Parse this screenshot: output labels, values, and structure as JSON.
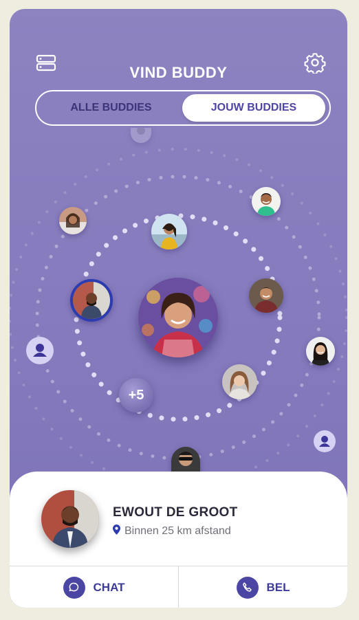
{
  "header": {
    "title": "VIND BUDDY",
    "menu_icon": "server-menu-icon",
    "settings_icon": "gear-icon"
  },
  "tabs": {
    "all": "ALLE BUDDIES",
    "mine": "JOUW BUDDIES",
    "selected": "mine"
  },
  "radar": {
    "more_count": "+5"
  },
  "profile": {
    "name": "EWOUT DE GROOT",
    "distance": "Binnen 25 km afstand"
  },
  "actions": {
    "chat": "CHAT",
    "call": "BEL"
  },
  "colors": {
    "accent": "#4b45a3",
    "background": "#857bbd",
    "selected_ring": "#2c3bb0"
  }
}
